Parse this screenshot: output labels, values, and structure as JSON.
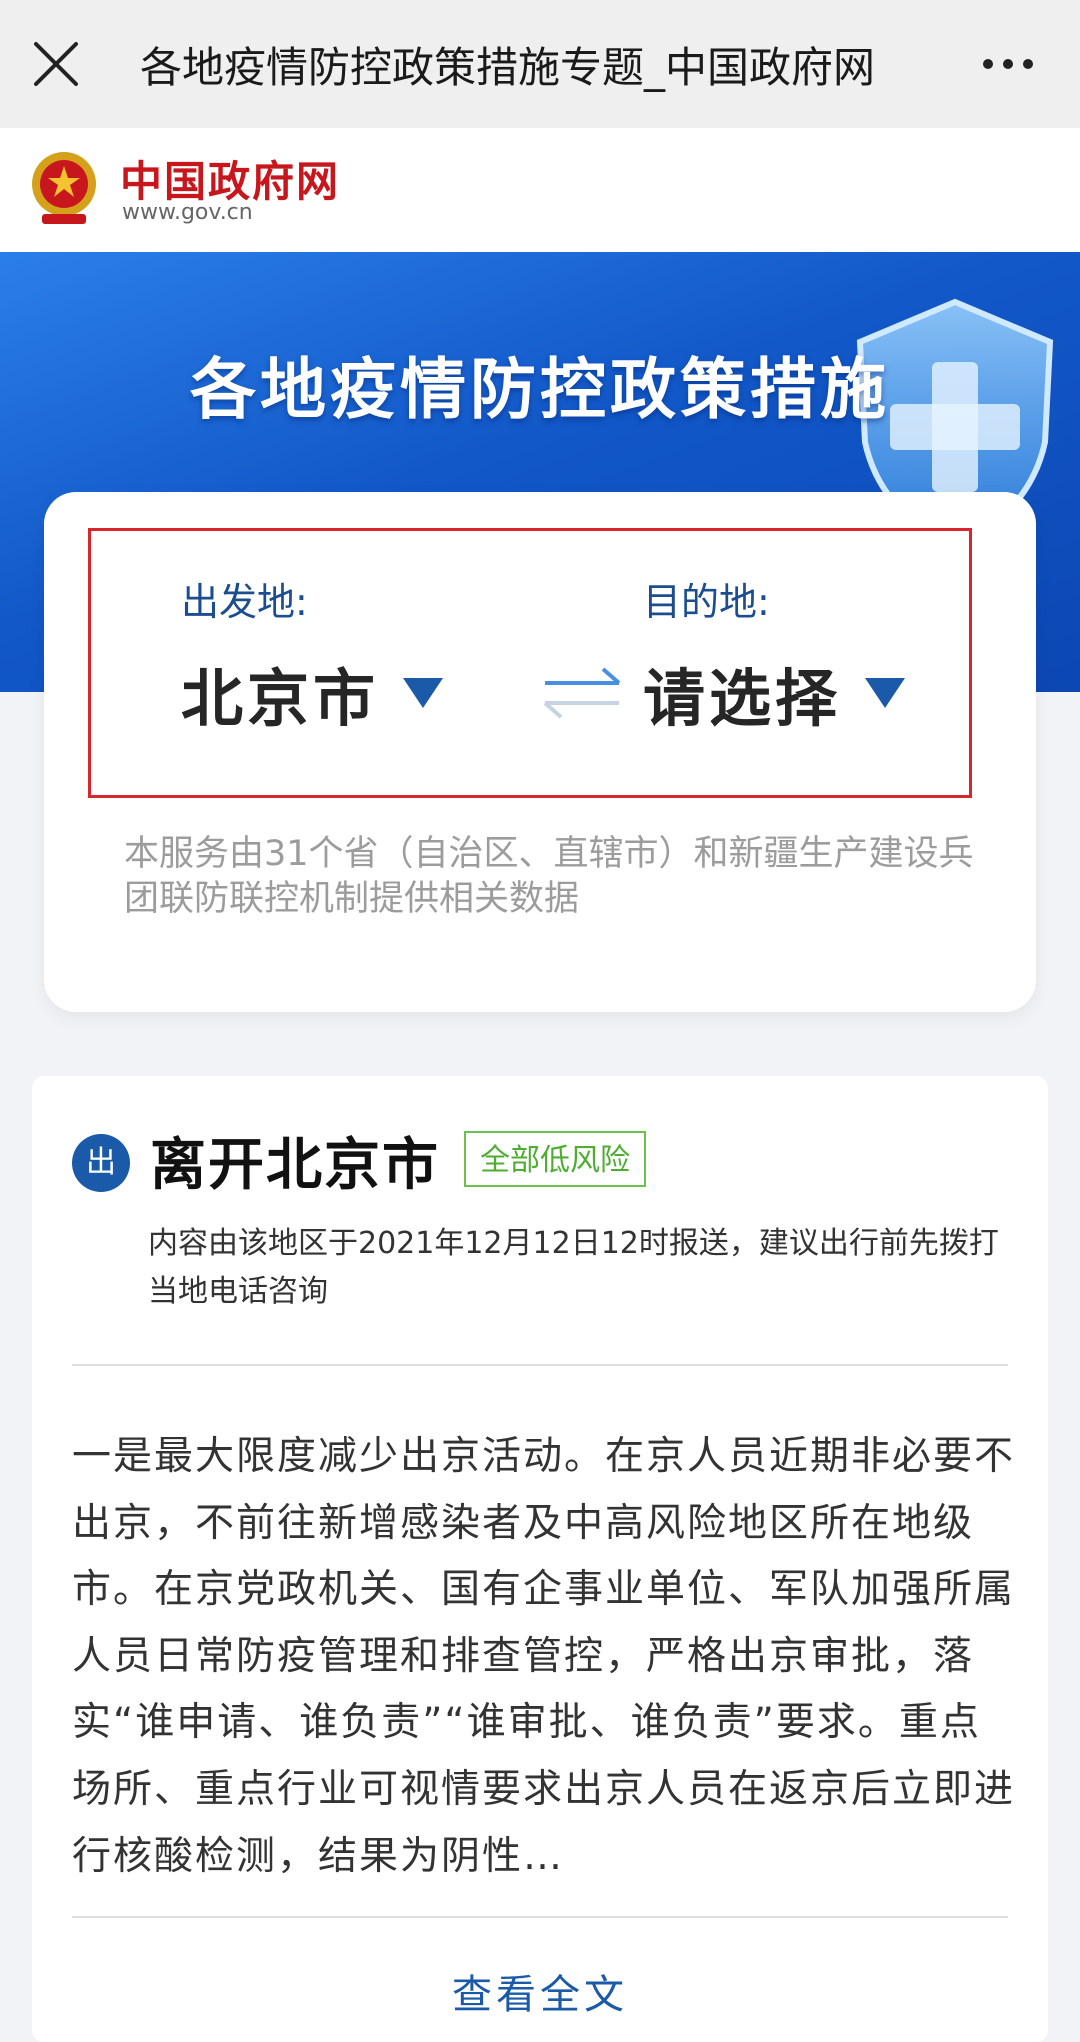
{
  "window": {
    "title": "各地疫情防控政策措施专题_中国政府网",
    "close_icon": "close-icon",
    "more_icon": "more-icon"
  },
  "site": {
    "name": "中国政府网",
    "url": "www.gov.cn"
  },
  "banner": {
    "title": "各地疫情防控政策措施"
  },
  "selector": {
    "origin_label": "出发地:",
    "origin_value": "北京市",
    "destination_label": "目的地:",
    "destination_value": "请选择",
    "swap_icon": "swap-arrows-icon",
    "service_note": "本服务由31个省（自治区、直辖市）和新疆生产建设兵团联防联控机制提供相关数据"
  },
  "leave": {
    "badge": "出",
    "title": "离开北京市",
    "risk_tag": "全部低风险",
    "report_note": "内容由该地区于2021年12月12日12时报送，建议出行前先拨打当地电话咨询",
    "policy_text": "一是最大限度减少出京活动。在京人员近期非必要不出京，不前往新增感染者及中高风险地区所在地级市。在京党政机关、国有企事业单位、军队加强所属人员日常防疫管理和排查管控，严格出京审批，落实“谁申请、谁负责”“谁审批、谁负责”要求。重点场所、重点行业可视情要求出京人员在返京后立即进行核酸检测，结果为阴性…",
    "view_all": "查看全文"
  },
  "colors": {
    "brand_red": "#c8161d",
    "brand_blue": "#1a5aa8",
    "risk_green": "#4fae32"
  }
}
